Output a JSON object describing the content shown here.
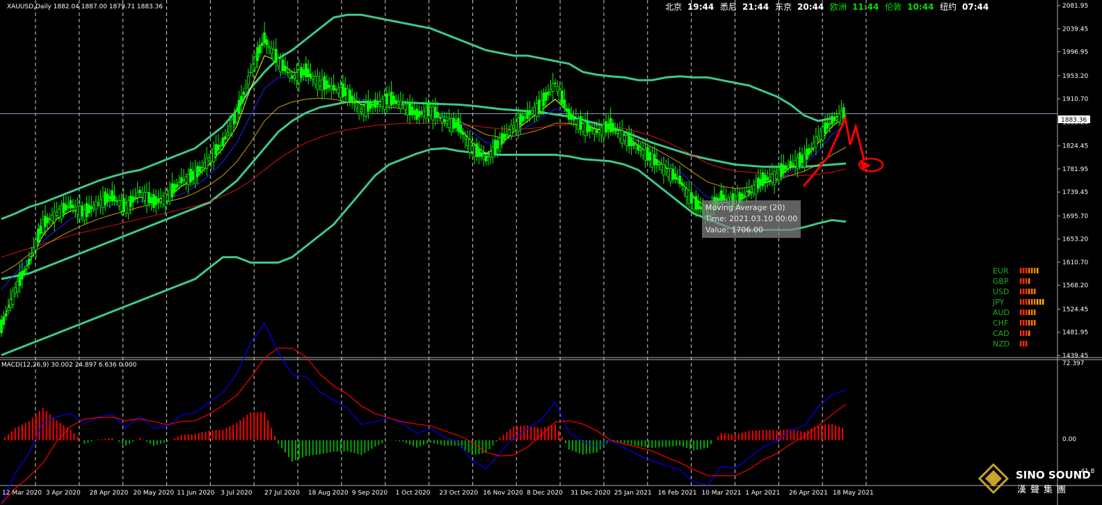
{
  "header": {
    "symbol_line": "XAUUSD,Daily  1882.04 1887.00 1879.71 1883.36",
    "clocks": [
      {
        "city": "北京",
        "time": "19:44",
        "highlight": false
      },
      {
        "city": "悉尼",
        "time": "21:44",
        "highlight": false
      },
      {
        "city": "东京",
        "time": "20:44",
        "highlight": false
      },
      {
        "city": "欧洲",
        "time": "11:44",
        "highlight": true
      },
      {
        "city": "伦敦",
        "time": "10:44",
        "highlight": true
      },
      {
        "city": "纽约",
        "time": "07:44",
        "highlight": false
      }
    ]
  },
  "tooltip": {
    "line1": "Moving Average (20)",
    "line2": "Time: 2021.03.10 00:00",
    "line3": "Value: 1706.00"
  },
  "macd": {
    "label": "MACD(12,26,9) 30.002 24.897 6.636 0.000",
    "axis_top": "72.397",
    "axis_zero": "0.00",
    "axis_bottom": "-41.8"
  },
  "current_price": "1883.36",
  "currency_strength": [
    {
      "code": "EUR",
      "bars": 7
    },
    {
      "code": "GBP",
      "bars": 4
    },
    {
      "code": "USD",
      "bars": 6
    },
    {
      "code": "JPY",
      "bars": 9
    },
    {
      "code": "AUD",
      "bars": 6
    },
    {
      "code": "CHF",
      "bars": 6
    },
    {
      "code": "CAD",
      "bars": 4
    },
    {
      "code": "NZD",
      "bars": 3
    }
  ],
  "logo": {
    "name": "SINO SOUND",
    "subtitle": "漢聲集團"
  },
  "colors": {
    "candle": "#00ff00",
    "bands": "#3ec98a",
    "ma_red": "#e01010",
    "ma_blue": "#2020ff",
    "ma_yellow": "#ffff00",
    "ma_orange": "#c8a000",
    "macd_line": "#0000ff",
    "signal_line": "#ff0000",
    "hist_pos": "#ff0000",
    "hist_neg": "#00aa00",
    "arrow": "#ff0000"
  },
  "chart_data": {
    "type": "line",
    "title": "",
    "ylim": [
      1439.45,
      2081.95
    ],
    "y_ticks": [
      "2081.95",
      "2039.45",
      "1996.95",
      "1953.20",
      "1910.70",
      "1868.20",
      "1824.45",
      "1781.95",
      "1739.45",
      "1695.70",
      "1653.20",
      "1610.70",
      "1568.20",
      "1524.45",
      "1481.95",
      "1439.45"
    ],
    "x_ticks": [
      "12 Mar 2020",
      "3 Apr 2020",
      "28 Apr 2020",
      "20 May 2020",
      "11 Jun 2020",
      "3 Jul 2020",
      "27 Jul 2020",
      "18 Aug 2020",
      "9 Sep 2020",
      "1 Oct 2020",
      "23 Oct 2020",
      "16 Nov 2020",
      "8 Dec 2020",
      "31 Dec 2020",
      "25 Jan 2021",
      "16 Feb 2021",
      "10 Mar 2021",
      "1 Apr 2021",
      "26 Apr 2021",
      "18 May 2021"
    ],
    "price_close": [
      1490,
      1560,
      1610,
      1680,
      1700,
      1715,
      1700,
      1720,
      1730,
      1710,
      1740,
      1720,
      1730,
      1760,
      1770,
      1800,
      1830,
      1880,
      1960,
      2020,
      1980,
      1950,
      1960,
      1940,
      1930,
      1920,
      1890,
      1900,
      1910,
      1900,
      1880,
      1890,
      1870,
      1860,
      1820,
      1800,
      1830,
      1860,
      1880,
      1900,
      1940,
      1880,
      1860,
      1850,
      1860,
      1840,
      1820,
      1800,
      1780,
      1760,
      1720,
      1700,
      1730,
      1720,
      1740,
      1760,
      1770,
      1790,
      1800,
      1840,
      1870,
      1885
    ],
    "series": [
      {
        "name": "",
        "values": [
          1495,
          1560,
          1610,
          1660,
          1690,
          1705,
          1705,
          1715,
          1725,
          1720,
          1730,
          1725,
          1730,
          1750,
          1765,
          1790,
          1820,
          1860,
          1930,
          1990,
          1980,
          1960,
          1955,
          1940,
          1930,
          1920,
          1900,
          1900,
          1905,
          1900,
          1885,
          1885,
          1870,
          1860,
          1830,
          1810,
          1825,
          1850,
          1870,
          1890,
          1910,
          1885,
          1865,
          1855,
          1855,
          1845,
          1825,
          1805,
          1785,
          1760,
          1730,
          1710,
          1720,
          1720,
          1735,
          1755,
          1765,
          1785,
          1800,
          1830,
          1860,
          1880
        ]
      },
      {
        "name": "",
        "values": [
          1560,
          1590,
          1620,
          1650,
          1670,
          1690,
          1700,
          1710,
          1715,
          1718,
          1722,
          1725,
          1727,
          1735,
          1750,
          1770,
          1795,
          1830,
          1880,
          1930,
          1950,
          1950,
          1945,
          1940,
          1930,
          1920,
          1910,
          1905,
          1905,
          1900,
          1890,
          1887,
          1878,
          1868,
          1850,
          1830,
          1830,
          1845,
          1860,
          1875,
          1892,
          1885,
          1870,
          1860,
          1856,
          1848,
          1832,
          1815,
          1797,
          1778,
          1752,
          1730,
          1726,
          1724,
          1732,
          1748,
          1760,
          1775,
          1790,
          1815,
          1845,
          1865
        ]
      },
      {
        "name": "",
        "values": [
          1590,
          1605,
          1625,
          1640,
          1655,
          1668,
          1680,
          1690,
          1698,
          1705,
          1712,
          1718,
          1722,
          1728,
          1738,
          1752,
          1770,
          1795,
          1830,
          1870,
          1895,
          1905,
          1910,
          1912,
          1910,
          1905,
          1900,
          1897,
          1895,
          1893,
          1888,
          1884,
          1878,
          1870,
          1858,
          1845,
          1840,
          1842,
          1848,
          1855,
          1866,
          1866,
          1860,
          1855,
          1850,
          1844,
          1834,
          1822,
          1808,
          1793,
          1775,
          1758,
          1750,
          1746,
          1748,
          1755,
          1762,
          1770,
          1778,
          1790,
          1808,
          1822
        ]
      },
      {
        "name": "",
        "values": [
          1620,
          1628,
          1636,
          1644,
          1652,
          1660,
          1666,
          1672,
          1678,
          1684,
          1690,
          1696,
          1702,
          1708,
          1714,
          1722,
          1732,
          1744,
          1760,
          1780,
          1800,
          1816,
          1830,
          1840,
          1848,
          1854,
          1858,
          1862,
          1864,
          1866,
          1866,
          1866,
          1865,
          1864,
          1862,
          1858,
          1856,
          1855,
          1856,
          1858,
          1862,
          1864,
          1864,
          1862,
          1860,
          1856,
          1850,
          1842,
          1832,
          1820,
          1806,
          1792,
          1784,
          1778,
          1776,
          1774,
          1772,
          1770,
          1770,
          1772,
          1776,
          1782
        ]
      },
      {
        "name": "",
        "values": [
          1690,
          1700,
          1712,
          1720,
          1730,
          1740,
          1750,
          1760,
          1768,
          1775,
          1780,
          1790,
          1800,
          1810,
          1820,
          1840,
          1860,
          1890,
          1930,
          1960,
          1985,
          2000,
          2020,
          2040,
          2060,
          2065,
          2065,
          2060,
          2055,
          2050,
          2045,
          2040,
          2030,
          2020,
          2010,
          2000,
          1995,
          1990,
          1990,
          1985,
          1980,
          1975,
          1960,
          1955,
          1952,
          1950,
          1945,
          1945,
          1950,
          1952,
          1950,
          1950,
          1945,
          1940,
          1935,
          1925,
          1915,
          1900,
          1880,
          1870,
          1875,
          1880
        ]
      },
      {
        "name": "",
        "values": [
          1580,
          1585,
          1590,
          1600,
          1610,
          1620,
          1630,
          1640,
          1650,
          1660,
          1670,
          1680,
          1690,
          1700,
          1710,
          1720,
          1740,
          1760,
          1790,
          1820,
          1850,
          1870,
          1885,
          1895,
          1900,
          1905,
          1905,
          1905,
          1905,
          1904,
          1903,
          1902,
          1901,
          1900,
          1898,
          1895,
          1892,
          1890,
          1888,
          1886,
          1882,
          1878,
          1872,
          1865,
          1858,
          1850,
          1840,
          1830,
          1822,
          1814,
          1806,
          1800,
          1795,
          1790,
          1788,
          1786,
          1786,
          1786,
          1786,
          1788,
          1790,
          1792
        ]
      },
      {
        "name": "",
        "values": [
          1440,
          1450,
          1460,
          1470,
          1480,
          1490,
          1500,
          1510,
          1520,
          1530,
          1540,
          1550,
          1560,
          1570,
          1580,
          1600,
          1620,
          1620,
          1610,
          1610,
          1610,
          1620,
          1640,
          1660,
          1680,
          1710,
          1740,
          1770,
          1790,
          1800,
          1810,
          1818,
          1820,
          1815,
          1812,
          1810,
          1808,
          1808,
          1808,
          1808,
          1808,
          1805,
          1800,
          1798,
          1796,
          1790,
          1780,
          1760,
          1740,
          1720,
          1700,
          1690,
          1680,
          1670,
          1670,
          1670,
          1670,
          1670,
          1675,
          1682,
          1688,
          1685
        ]
      }
    ]
  }
}
